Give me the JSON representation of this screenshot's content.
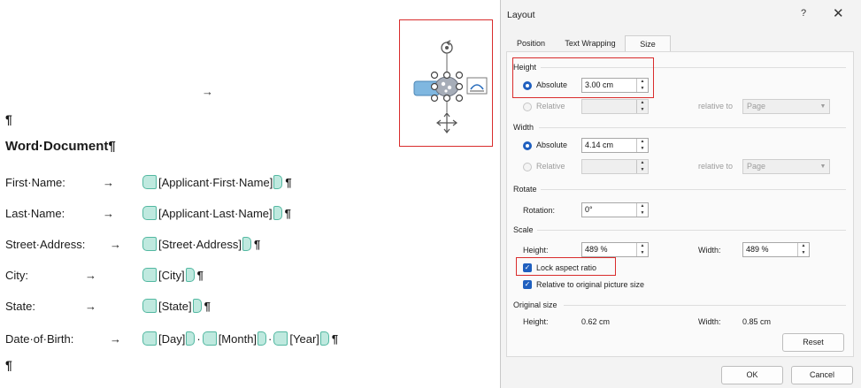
{
  "document": {
    "pilcrow": "¶",
    "arrow": "→",
    "title": "Word·Document¶",
    "fields": [
      {
        "label": "First·Name:",
        "arrow": "→",
        "controls": [
          "[Applicant·First·Name]"
        ],
        "end": "¶"
      },
      {
        "label": "Last·Name:",
        "arrow": "→",
        "controls": [
          "[Applicant·Last·Name]"
        ],
        "end": "¶"
      },
      {
        "label": "Street·Address:",
        "arrow": "→",
        "controls": [
          "[Street·Address]"
        ],
        "end": "¶"
      },
      {
        "label": "City:",
        "arrow": "→",
        "controls": [
          "[City]"
        ],
        "end": "¶"
      },
      {
        "label": "State:",
        "arrow": "→",
        "controls": [
          "[State]"
        ],
        "end": "¶"
      },
      {
        "label": "Date·of·Birth:",
        "arrow": "→",
        "controls": [
          "[Day]",
          "[Month]",
          "[Year]"
        ],
        "separator": "·",
        "end": "¶"
      }
    ],
    "last_pilcrow": "¶"
  },
  "dialog": {
    "title": "Layout",
    "help": "?",
    "close": "✕",
    "tabs": [
      {
        "label": "Position",
        "active": false
      },
      {
        "label": "Text Wrapping",
        "active": false
      },
      {
        "label": "Size",
        "active": true
      }
    ],
    "height": {
      "header": "Height",
      "absolute_label": "Absolute",
      "absolute_value": "3.00 cm",
      "relative_label": "Relative",
      "relative_to_label": "relative to",
      "relative_to_value": "Page"
    },
    "width": {
      "header": "Width",
      "absolute_label": "Absolute",
      "absolute_value": "4.14 cm",
      "relative_label": "Relative",
      "relative_to_label": "relative to",
      "relative_to_value": "Page"
    },
    "rotate": {
      "header": "Rotate",
      "rotation_label": "Rotation:",
      "rotation_value": "0°"
    },
    "scale": {
      "header": "Scale",
      "height_label": "Height:",
      "height_value": "489 %",
      "width_label": "Width:",
      "width_value": "489 %",
      "lock_aspect_label": "Lock aspect ratio",
      "relative_original_label": "Relative to original picture size"
    },
    "original_size": {
      "header": "Original size",
      "height_label": "Height:",
      "height_value": "0.62 cm",
      "width_label": "Width:",
      "width_value": "0.85 cm"
    },
    "buttons": {
      "reset": "Reset",
      "ok": "OK",
      "cancel": "Cancel"
    },
    "colors": {
      "accent": "#1f5fbf",
      "highlight": "#d92c2c",
      "content_control": "#bfe9df"
    }
  }
}
